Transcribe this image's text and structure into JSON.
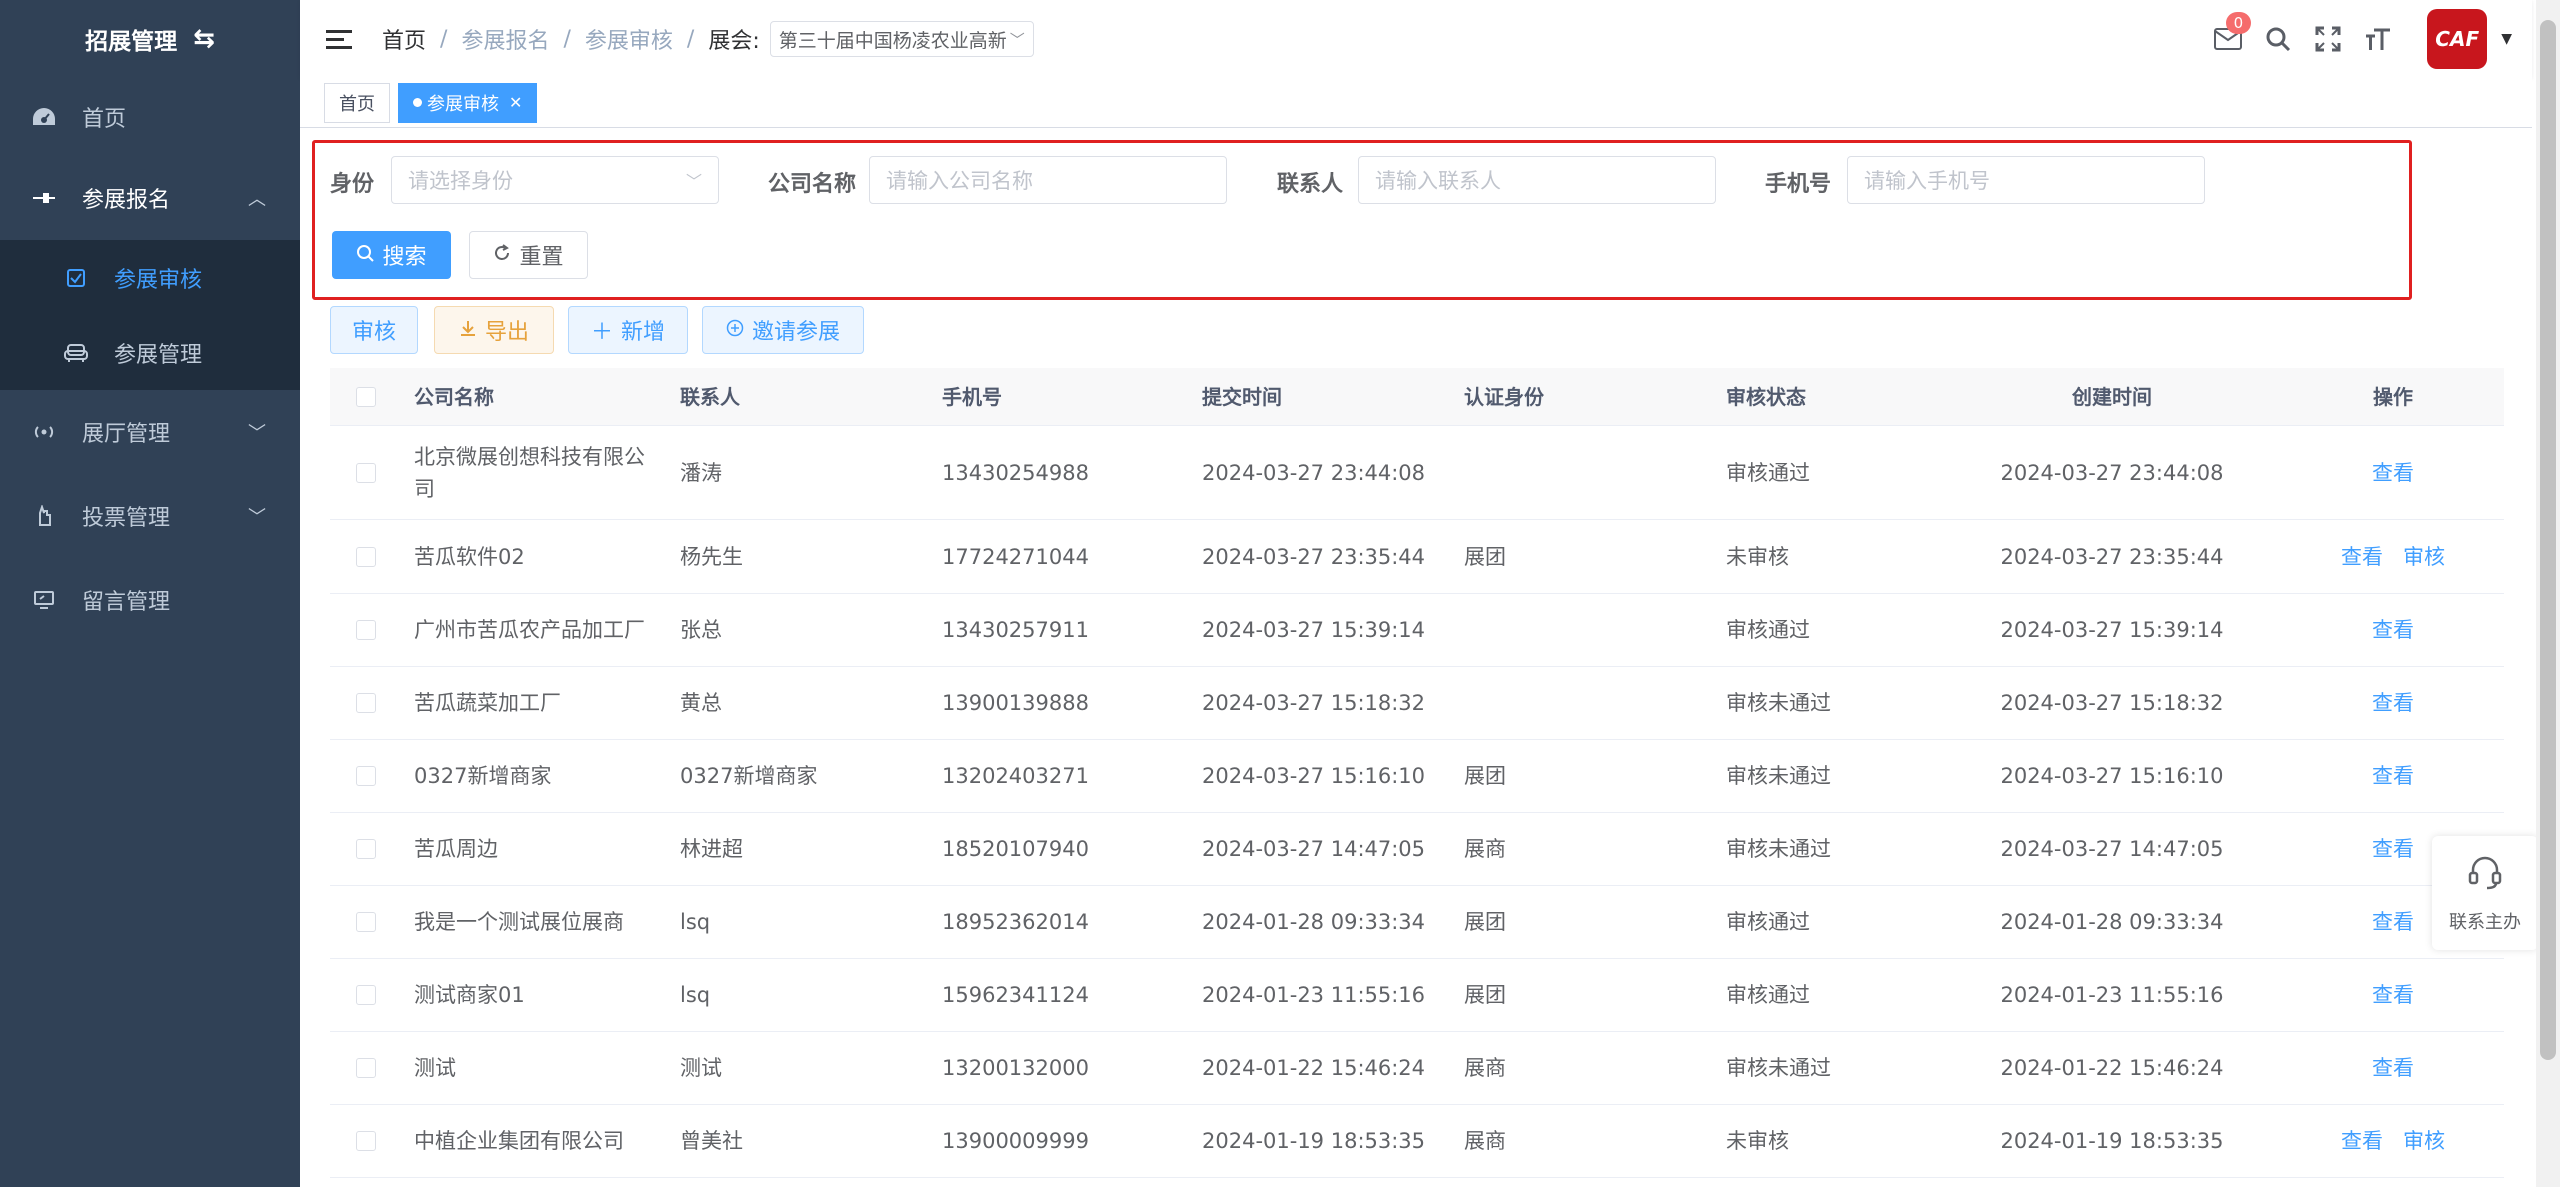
{
  "sidebar": {
    "title": "招展管理",
    "items": [
      {
        "label": "首页"
      },
      {
        "label": "参展报名"
      },
      {
        "label": "参展审核"
      },
      {
        "label": "参展管理"
      },
      {
        "label": "展厅管理"
      },
      {
        "label": "投票管理"
      },
      {
        "label": "留言管理"
      }
    ]
  },
  "navbar": {
    "breadcrumb": [
      "首页",
      "参展报名",
      "参展审核"
    ],
    "expo_label": "展会:",
    "expo_value": "第三十届中国杨凌农业高新",
    "mail_badge": "0",
    "avatar_text": "CAF"
  },
  "tags": {
    "home": "首页",
    "active": "参展审核"
  },
  "search": {
    "identity_label": "身份",
    "identity_placeholder": "请选择身份",
    "company_label": "公司名称",
    "company_placeholder": "请输入公司名称",
    "contact_label": "联系人",
    "contact_placeholder": "请输入联系人",
    "phone_label": "手机号",
    "phone_placeholder": "请输入手机号",
    "search_btn": "搜索",
    "reset_btn": "重置"
  },
  "toolbar": {
    "audit": "审核",
    "export": "导出",
    "add": "新增",
    "invite": "邀请参展"
  },
  "table": {
    "headers": [
      "公司名称",
      "联系人",
      "手机号",
      "提交时间",
      "认证身份",
      "审核状态",
      "创建时间",
      "操作"
    ],
    "view_label": "查看",
    "audit_label": "审核",
    "rows": [
      {
        "company": "北京微展创想科技有限公司",
        "contact": "潘涛",
        "phone": "13430254988",
        "submit": "2024-03-27 23:44:08",
        "identity": "",
        "status": "审核通过",
        "created": "2024-03-27 23:44:08",
        "can_audit": false
      },
      {
        "company": "苦瓜软件02",
        "contact": "杨先生",
        "phone": "17724271044",
        "submit": "2024-03-27 23:35:44",
        "identity": "展团",
        "status": "未审核",
        "created": "2024-03-27 23:35:44",
        "can_audit": true
      },
      {
        "company": "广州市苦瓜农产品加工厂",
        "contact": "张总",
        "phone": "13430257911",
        "submit": "2024-03-27 15:39:14",
        "identity": "",
        "status": "审核通过",
        "created": "2024-03-27 15:39:14",
        "can_audit": false
      },
      {
        "company": "苦瓜蔬菜加工厂",
        "contact": "黄总",
        "phone": "13900139888",
        "submit": "2024-03-27 15:18:32",
        "identity": "",
        "status": "审核未通过",
        "created": "2024-03-27 15:18:32",
        "can_audit": false
      },
      {
        "company": "0327新增商家",
        "contact": "0327新增商家",
        "phone": "13202403271",
        "submit": "2024-03-27 15:16:10",
        "identity": "展团",
        "status": "审核未通过",
        "created": "2024-03-27 15:16:10",
        "can_audit": false
      },
      {
        "company": "苦瓜周边",
        "contact": "林进超",
        "phone": "18520107940",
        "submit": "2024-03-27 14:47:05",
        "identity": "展商",
        "status": "审核未通过",
        "created": "2024-03-27 14:47:05",
        "can_audit": false
      },
      {
        "company": "我是一个测试展位展商",
        "contact": "lsq",
        "phone": "18952362014",
        "submit": "2024-01-28 09:33:34",
        "identity": "展团",
        "status": "审核通过",
        "created": "2024-01-28 09:33:34",
        "can_audit": false
      },
      {
        "company": "测试商家01",
        "contact": "lsq",
        "phone": "15962341124",
        "submit": "2024-01-23 11:55:16",
        "identity": "展团",
        "status": "审核通过",
        "created": "2024-01-23 11:55:16",
        "can_audit": false
      },
      {
        "company": "测试",
        "contact": "测试",
        "phone": "13200132000",
        "submit": "2024-01-22 15:46:24",
        "identity": "展商",
        "status": "审核未通过",
        "created": "2024-01-22 15:46:24",
        "can_audit": false
      },
      {
        "company": "中植企业集团有限公司",
        "contact": "曾美社",
        "phone": "13900009999",
        "submit": "2024-01-19 18:53:35",
        "identity": "展商",
        "status": "未审核",
        "created": "2024-01-19 18:53:35",
        "can_audit": true
      }
    ]
  },
  "float_contact": {
    "label": "联系主办"
  }
}
